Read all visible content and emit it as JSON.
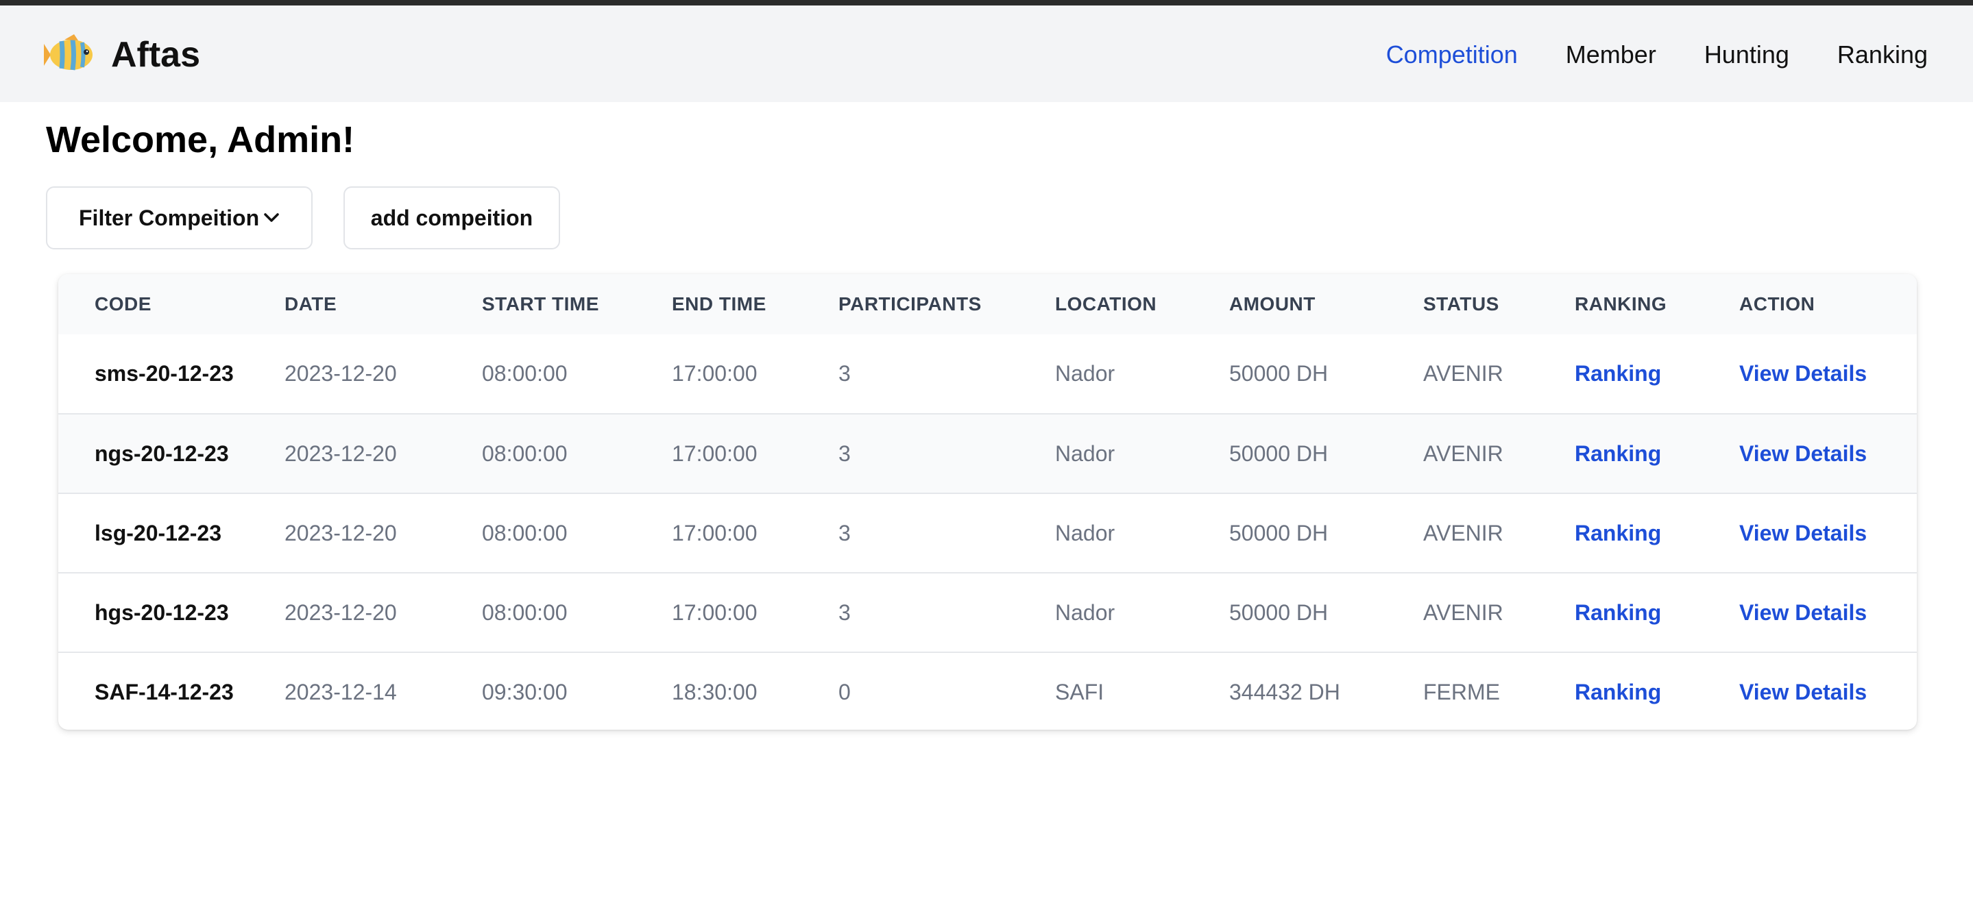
{
  "brand": {
    "name": "Aftas",
    "logo_icon": "fish-icon"
  },
  "nav": {
    "active": "Competition",
    "links": [
      "Competition",
      "Member",
      "Hunting",
      "Ranking"
    ]
  },
  "colors": {
    "accent": "#1d4ed8",
    "navbar_bg": "#f3f4f6",
    "header_row_bg": "#f9fafb"
  },
  "page": {
    "welcome": "Welcome, Admin!"
  },
  "toolbar": {
    "filter_label": "Filter Compeition",
    "add_label": "add compeition"
  },
  "table": {
    "headers": [
      "CODE",
      "DATE",
      "START TIME",
      "END TIME",
      "PARTICIPANTS",
      "LOCATION",
      "AMOUNT",
      "STATUS",
      "RANKING",
      "ACTION"
    ],
    "rows": [
      {
        "code": "sms-20-12-23",
        "date": "2023-12-20",
        "start": "08:00:00",
        "end": "17:00:00",
        "participants": "3",
        "location": "Nador",
        "amount": "50000 DH",
        "status": "AVENIR",
        "ranking": "Ranking",
        "action": "View Details"
      },
      {
        "code": "ngs-20-12-23",
        "date": "2023-12-20",
        "start": "08:00:00",
        "end": "17:00:00",
        "participants": "3",
        "location": "Nador",
        "amount": "50000 DH",
        "status": "AVENIR",
        "ranking": "Ranking",
        "action": "View Details"
      },
      {
        "code": "lsg-20-12-23",
        "date": "2023-12-20",
        "start": "08:00:00",
        "end": "17:00:00",
        "participants": "3",
        "location": "Nador",
        "amount": "50000 DH",
        "status": "AVENIR",
        "ranking": "Ranking",
        "action": "View Details"
      },
      {
        "code": "hgs-20-12-23",
        "date": "2023-12-20",
        "start": "08:00:00",
        "end": "17:00:00",
        "participants": "3",
        "location": "Nador",
        "amount": "50000 DH",
        "status": "AVENIR",
        "ranking": "Ranking",
        "action": "View Details"
      },
      {
        "code": "SAF-14-12-23",
        "date": "2023-12-14",
        "start": "09:30:00",
        "end": "18:30:00",
        "participants": "0",
        "location": "SAFI",
        "amount": "344432 DH",
        "status": "FERME",
        "ranking": "Ranking",
        "action": "View Details"
      }
    ]
  }
}
